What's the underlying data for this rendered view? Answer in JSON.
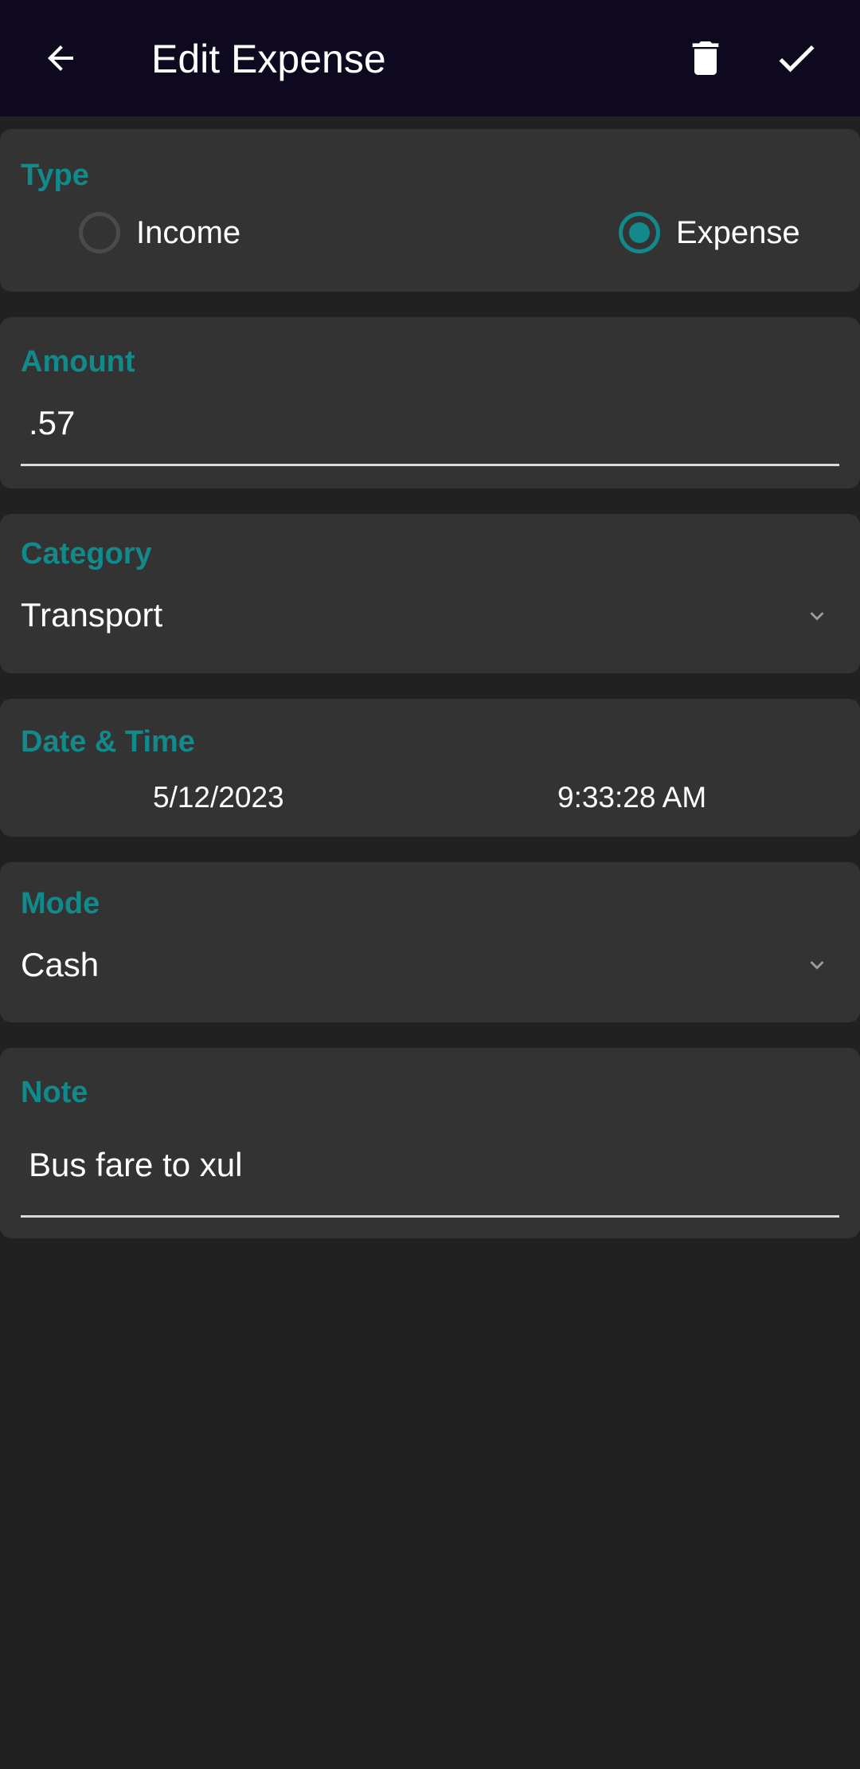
{
  "header": {
    "title": "Edit Expense",
    "back_icon": "arrow-left-icon",
    "delete_icon": "trash-icon",
    "save_icon": "check-icon"
  },
  "type": {
    "label": "Type",
    "options": [
      {
        "label": "Income",
        "checked": false
      },
      {
        "label": "Expense",
        "checked": true
      }
    ]
  },
  "amount": {
    "label": "Amount",
    "value": ".57"
  },
  "category": {
    "label": "Category",
    "value": "Transport"
  },
  "datetime": {
    "label": "Date & Time",
    "date": "5/12/2023",
    "time": "9:33:28 AM"
  },
  "mode": {
    "label": "Mode",
    "value": "Cash"
  },
  "note": {
    "label": "Note",
    "value": "Bus fare to xul"
  },
  "colors": {
    "accent": "#12898a",
    "appbar": "#0f0920",
    "card": "#333333",
    "background": "#212121"
  }
}
